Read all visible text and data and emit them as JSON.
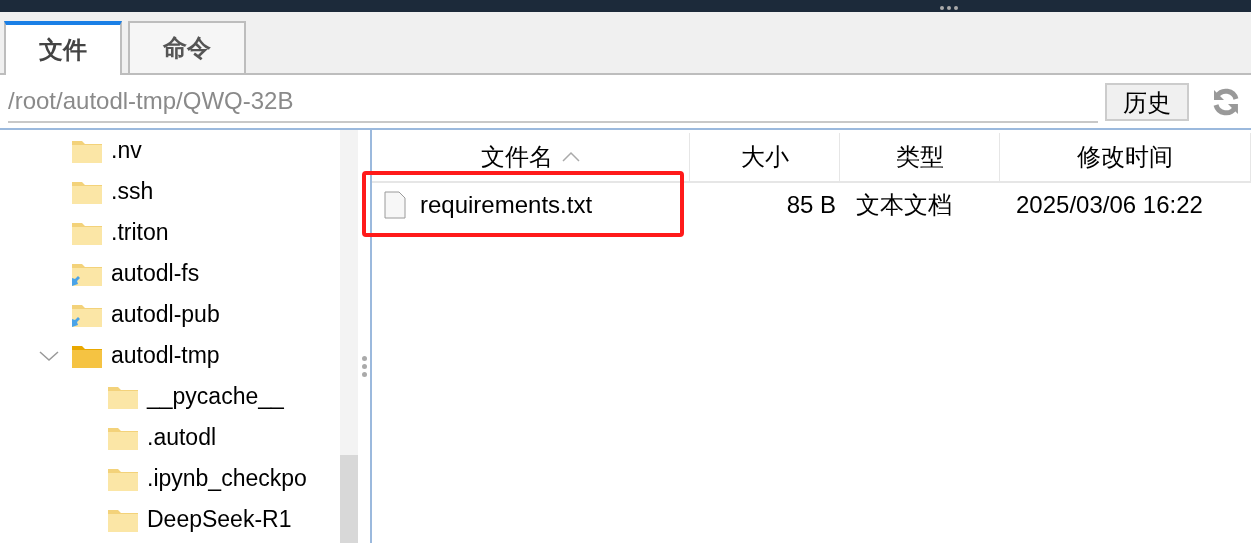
{
  "tabs": [
    {
      "label": "文件",
      "selected": true
    },
    {
      "label": "命令",
      "selected": false
    }
  ],
  "path_bar": {
    "path": "/root/autodl-tmp/QWQ-32B",
    "history_button": "历史"
  },
  "tree": [
    {
      "name": ".nv",
      "kind": "folder"
    },
    {
      "name": ".ssh",
      "kind": "folder"
    },
    {
      "name": ".triton",
      "kind": "folder"
    },
    {
      "name": "autodl-fs",
      "kind": "shortcut"
    },
    {
      "name": "autodl-pub",
      "kind": "shortcut"
    },
    {
      "name": "autodl-tmp",
      "kind": "folder",
      "expanded": true,
      "children": [
        {
          "name": "__pycache__",
          "kind": "folder"
        },
        {
          "name": ".autodl",
          "kind": "folder"
        },
        {
          "name": ".ipynb_checkpo",
          "kind": "folder"
        },
        {
          "name": "DeepSeek-R1",
          "kind": "folder"
        }
      ]
    }
  ],
  "table": {
    "columns": [
      {
        "label": "文件名",
        "sorted": true
      },
      {
        "label": "大小",
        "sorted": false
      },
      {
        "label": "类型",
        "sorted": false
      },
      {
        "label": "修改时间",
        "sorted": false
      }
    ],
    "rows": [
      {
        "name": "requirements.txt",
        "size": "85 B",
        "type": "文本文档",
        "modified": "2025/03/06 16:22",
        "highlighted": true
      }
    ]
  }
}
